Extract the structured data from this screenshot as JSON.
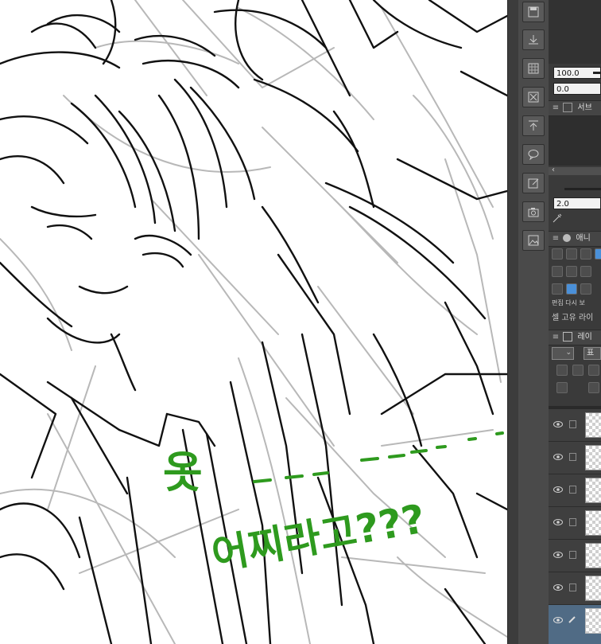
{
  "canvas": {
    "annotation_line1": "옷",
    "annotation_line2": "어찌라고???",
    "annotation_color": "#2e9a1e",
    "line_color": "#111111",
    "sketch_color": "#b8b8b8"
  },
  "toolstrip": {
    "icons": [
      "save-icon",
      "export-icon",
      "pattern-icon",
      "clear-icon",
      "import-icon",
      "speech-bubble-icon",
      "edit-icon",
      "camera-icon",
      "image-icon"
    ]
  },
  "panel": {
    "opacity_value": "100.0",
    "offset_value": "0.0",
    "sub_view_label": "서브",
    "brush_size_value": "2.0",
    "animation_label": "애니",
    "property_label": "편집 다시 보",
    "unique_label": "셀 고유 라이",
    "layer_label": "레이",
    "blend_label": "표",
    "accent_color": "#4a90d9",
    "layers_count_visible": 7
  }
}
